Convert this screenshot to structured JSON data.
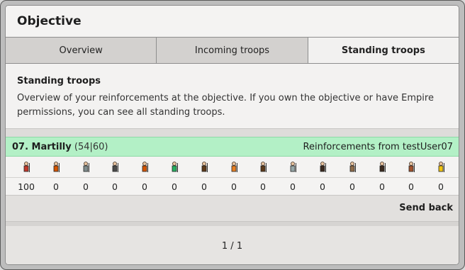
{
  "window": {
    "title": "Objective"
  },
  "tabs": [
    {
      "label": "Overview",
      "active": false
    },
    {
      "label": "Incoming troops",
      "active": false
    },
    {
      "label": "Standing troops",
      "active": true
    }
  ],
  "description": {
    "heading": "Standing troops",
    "text": "Overview of your reinforcements at the objective. If you own the objective or have Empire permissions, you can see all standing troops."
  },
  "reinforcement": {
    "village_name": "07. Martilly",
    "coords": "(54|60)",
    "from_label": "Reinforcements from testUser07",
    "units": [
      {
        "icon": "spear-fighter-icon",
        "color": "#c0392b",
        "count": "100"
      },
      {
        "icon": "swordsman-icon",
        "color": "#d35400",
        "count": "0"
      },
      {
        "icon": "axe-fighter-icon",
        "color": "#7f8c8d",
        "count": "0"
      },
      {
        "icon": "archer-icon",
        "color": "#4a4a4a",
        "count": "0"
      },
      {
        "icon": "scout-icon",
        "color": "#d35400",
        "count": "0"
      },
      {
        "icon": "light-cavalry-icon",
        "color": "#27ae60",
        "count": "0"
      },
      {
        "icon": "mounted-archer-icon",
        "color": "#5d3a1a",
        "count": "0"
      },
      {
        "icon": "heavy-cavalry-icon",
        "color": "#e67e22",
        "count": "0"
      },
      {
        "icon": "ram-icon",
        "color": "#5d3a1a",
        "count": "0"
      },
      {
        "icon": "catapult-icon",
        "color": "#95a5a6",
        "count": "0"
      },
      {
        "icon": "knight-icon",
        "color": "#3b2a20",
        "count": "0"
      },
      {
        "icon": "snob-icon",
        "color": "#8e6b4a",
        "count": "0"
      },
      {
        "icon": "militia-icon",
        "color": "#3b2a20",
        "count": "0"
      },
      {
        "icon": "wagon-icon",
        "color": "#a0522d",
        "count": "0"
      },
      {
        "icon": "nobleman-icon",
        "color": "#f1c40f",
        "count": "0"
      }
    ]
  },
  "actions": {
    "send_back": "Send back"
  },
  "pagination": {
    "text": "1 / 1"
  }
}
